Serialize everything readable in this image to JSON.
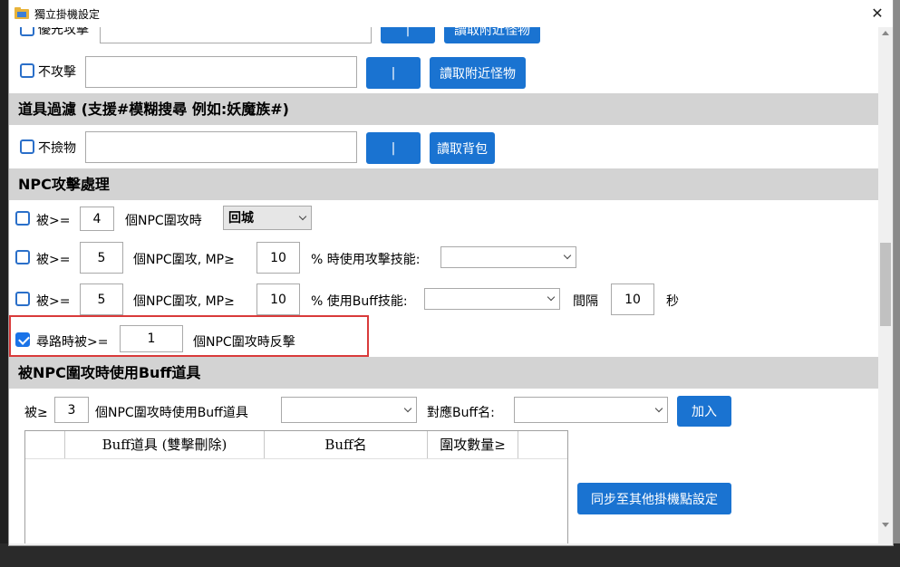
{
  "window": {
    "title": "獨立掛機設定"
  },
  "row_top": {
    "label": "優先攻擊",
    "pipe_button": "|",
    "read_button": "讀取附近怪物"
  },
  "row_no_attack": {
    "label": "不攻擊",
    "pipe_button": "|",
    "read_button": "讀取附近怪物"
  },
  "section_item_filter": {
    "title": "道具過濾 (支援#模糊搜尋 例如:妖魔族#)"
  },
  "row_no_pickup": {
    "label": "不撿物",
    "pipe_button": "|",
    "read_button": "讀取背包"
  },
  "section_npc_attack": {
    "title": "NPC攻擊處理"
  },
  "npc_row1": {
    "prefix": "被>=",
    "count": "4",
    "suffix": "個NPC圍攻時",
    "action": "回城"
  },
  "npc_row2": {
    "prefix": "被>=",
    "count": "5",
    "mid": "個NPC圍攻, MP≥",
    "mp": "10",
    "suffix": "% 時使用攻擊技能:",
    "skill": ""
  },
  "npc_row3": {
    "prefix": "被>=",
    "count": "5",
    "mid": "個NPC圍攻, MP≥",
    "mp": "10",
    "suffix": "% 使用Buff技能:",
    "skill": "",
    "interval_label": "間隔",
    "interval": "10",
    "unit": "秒"
  },
  "npc_row4": {
    "checked": true,
    "prefix": "尋路時被>=",
    "count": "1",
    "suffix": "個NPC圍攻時反擊"
  },
  "section_buff_item": {
    "title": "被NPC圍攻時使用Buff道具"
  },
  "buff_row": {
    "prefix": "被≥",
    "count": "3",
    "mid": "個NPC圍攻時使用Buff道具",
    "item": "",
    "name_label": "對應Buff名:",
    "name_value": "",
    "add_button": "加入"
  },
  "buff_table": {
    "columns": [
      "Buff道具 (雙擊刪除)",
      "Buff名",
      "圍攻數量≥"
    ],
    "rows": []
  },
  "sync_button": "同步至其他掛機點設定"
}
